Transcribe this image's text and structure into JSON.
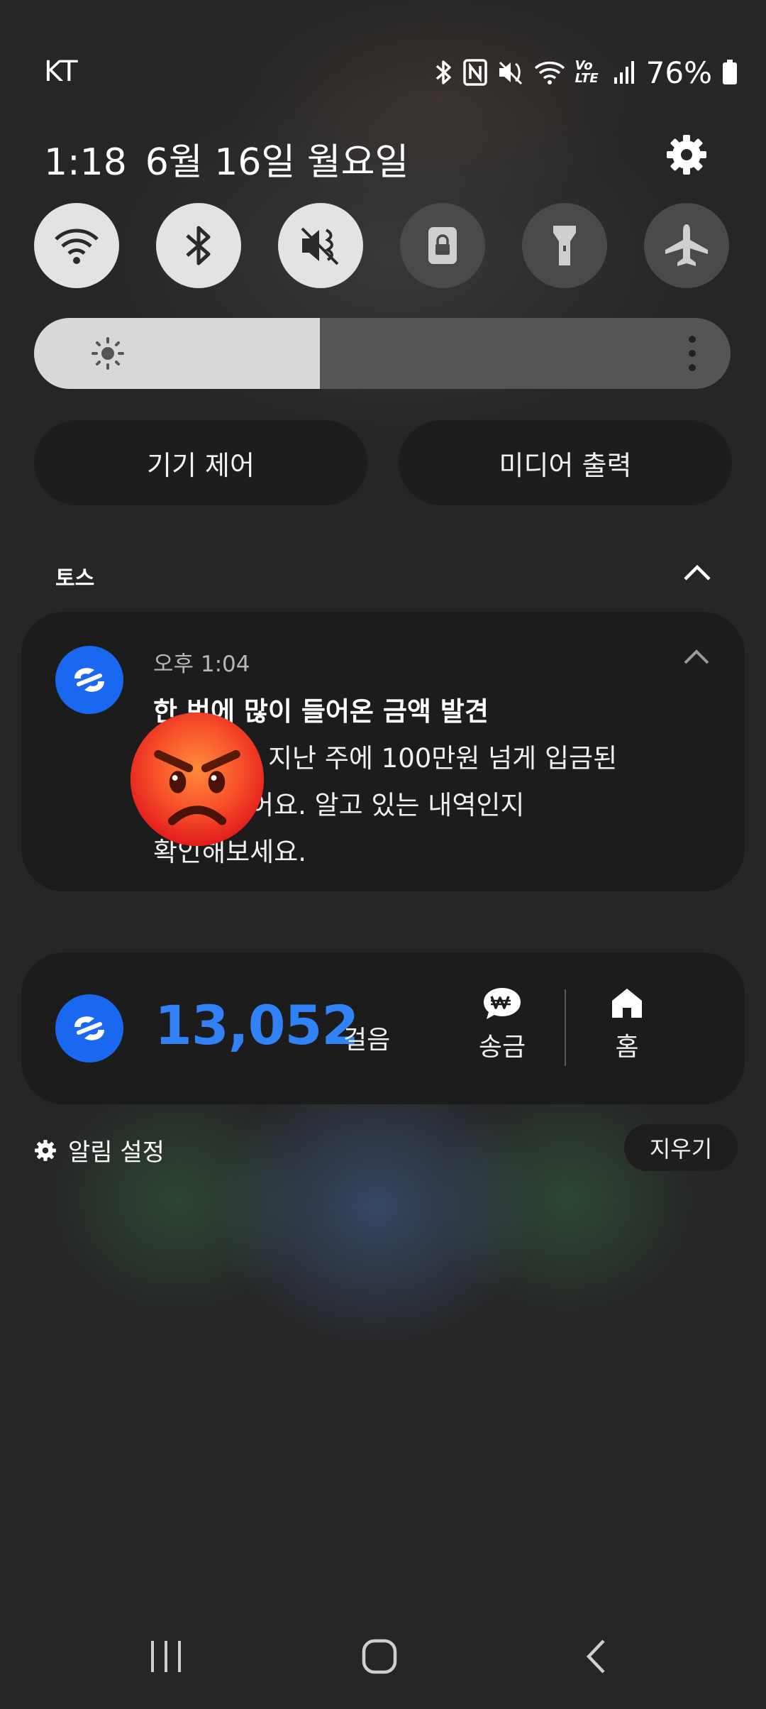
{
  "status_bar": {
    "carrier": "KT",
    "volte_label": "Vo LTE",
    "battery_percent": "76%",
    "icons": [
      "bluetooth-icon",
      "nfc-icon",
      "mute-icon",
      "wifi-icon",
      "volte-icon",
      "signal-icon",
      "battery-icon"
    ]
  },
  "header": {
    "time": "1:18",
    "date": "6월 16일 월요일",
    "settings_icon": "gear-icon"
  },
  "quick_settings": {
    "toggles": [
      {
        "icon": "wifi-icon",
        "state": "on"
      },
      {
        "icon": "bluetooth-icon",
        "state": "on"
      },
      {
        "icon": "sound-mute-icon",
        "state": "on"
      },
      {
        "icon": "screen-lock-icon",
        "state": "off"
      },
      {
        "icon": "flashlight-icon",
        "state": "off"
      },
      {
        "icon": "airplane-icon",
        "state": "off"
      }
    ],
    "brightness_level": 0.41,
    "device_control_label": "기기 제어",
    "media_output_label": "미디어 출력"
  },
  "notification_group": {
    "app_name": "토스",
    "notification": {
      "time": "오후 1:04",
      "title": "한 번에 많이 들어온 금액 발견",
      "body_lines": [
        "지난 주에 100만원 넘게 입금된",
        "어요. 알고 있는 내역인지",
        "확인해보세요."
      ],
      "overlay_emoji": "😡"
    }
  },
  "steps_widget": {
    "value": "13,052",
    "unit": "걸음",
    "send_label": "송금",
    "home_label": "홈"
  },
  "footer": {
    "settings_label": "알림 설정",
    "clear_label": "지우기"
  },
  "colors": {
    "background": "#262626",
    "card": "#1c1c1c",
    "toss_blue": "#1a68f0",
    "steps_blue": "#3182f6",
    "toggle_on": "#e3e3e3",
    "toggle_off": "#4a4a4a"
  },
  "nav_bar": {
    "icons": [
      "recent-apps-icon",
      "home-icon",
      "back-icon"
    ]
  }
}
